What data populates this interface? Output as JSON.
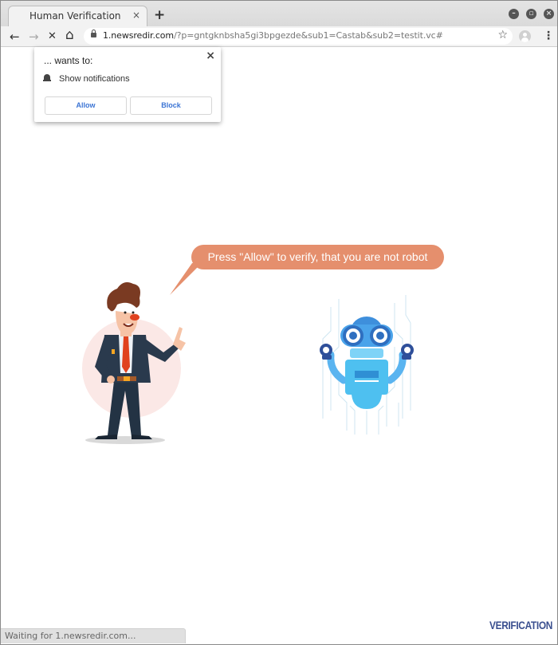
{
  "browser": {
    "tab": {
      "title": "Human Verification",
      "close": "×"
    },
    "new_tab": "+",
    "window_controls": {
      "minimize": "–",
      "maximize": "▫",
      "close": "×"
    },
    "nav": {
      "back": "←",
      "forward": "→",
      "stop": "✕",
      "home": "⌂"
    },
    "url": {
      "host": "1.newsredir.com",
      "rest": "/?p=gntgknbsha5gi3bpgezde&sub1=Castab&sub2=testit.vc#"
    },
    "icons": {
      "star": "☆",
      "menu": "⋮"
    },
    "status": "Waiting for 1.newsredir.com..."
  },
  "permission_popup": {
    "title": "... wants to:",
    "close": "×",
    "permission": "Show notifications",
    "allow_label": "Allow",
    "block_label": "Block"
  },
  "page": {
    "bubble_text": "Press \"Allow\" to verify, that you are not robot",
    "brand": "VERIFICATION",
    "colors": {
      "bubble": "#e58f6d",
      "brand": "#3a4f8f",
      "button_text": "#3b74d4"
    }
  }
}
